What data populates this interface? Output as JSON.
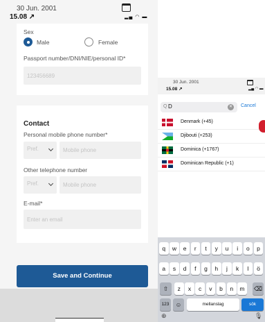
{
  "left_screen": {
    "status": {
      "date": "30 Jun. 2001",
      "time": "15.08 ↗"
    },
    "personal": {
      "sex_label": "Sex",
      "sex_options": [
        "Male",
        "Female"
      ],
      "sex_selected": "Male",
      "passport_label": "Passport number/DNI/NIE/personal ID*",
      "passport_value": "123456689"
    },
    "contact": {
      "title": "Contact",
      "mobile_label": "Personal mobile phone number*",
      "mobile_prefix": "Pref.",
      "mobile_placeholder": "Mobile phone",
      "other_label": "Other telephone number",
      "other_prefix": "Pref.",
      "other_placeholder": "Mobile phone",
      "email_label": "E-mail*",
      "email_placeholder": "Enter an email"
    },
    "save_button": "Save and Continue"
  },
  "right_screen": {
    "status": {
      "date": "30 Jun. 2001",
      "time": "15.08 ↗"
    },
    "search": {
      "icon": "Q",
      "value": "D",
      "cancel": "Cancel"
    },
    "countries": [
      {
        "name": "Denmark (+45)",
        "flag": "denmark-flag"
      },
      {
        "name": "Djibouti (+253)",
        "flag": "djibouti-flag"
      },
      {
        "name": "Dominica (+1767)",
        "flag": "dominica-flag"
      },
      {
        "name": "Dominican Republic (+1)",
        "flag": "dominican-republic-flag"
      }
    ],
    "keyboard": {
      "row1": [
        "q",
        "w",
        "e",
        "r",
        "t",
        "y",
        "u",
        "i",
        "o",
        "p"
      ],
      "row2": [
        "a",
        "s",
        "d",
        "f",
        "g",
        "h",
        "j",
        "k",
        "l",
        "ö"
      ],
      "row3": [
        "z",
        "x",
        "c",
        "v",
        "b",
        "n",
        "m"
      ],
      "num_key": "123",
      "space_key": "mellanslag",
      "return_key": "sök"
    }
  },
  "colors": {
    "primary": "#1e5a96",
    "ios_blue": "#1a78d6"
  }
}
